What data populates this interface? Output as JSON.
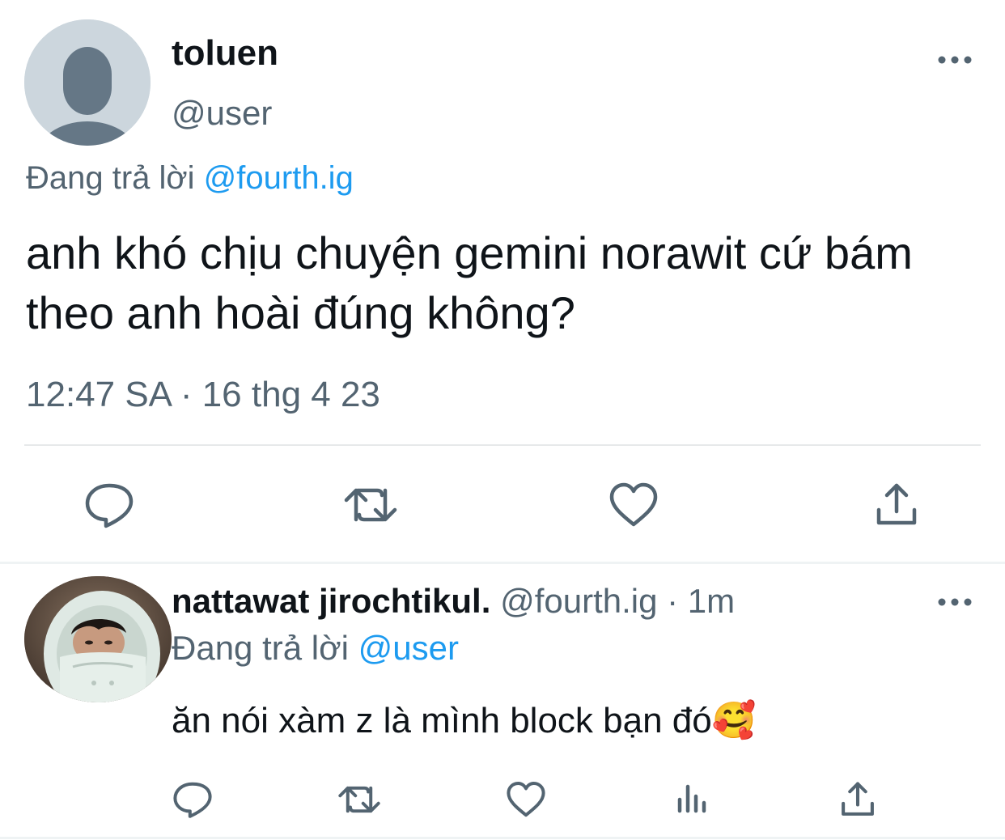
{
  "tweet": {
    "author": {
      "name": "toluen",
      "handle": "@user"
    },
    "replying_to": {
      "prefix": "Đang trả lời",
      "mention": "@fourth.ig"
    },
    "text": "anh khó chịu chuyện gemini norawit cứ bám theo anh hoài đúng không?",
    "timestamp": "12:47 SA · 16 thg 4 23",
    "actions": [
      "reply-icon",
      "retweet-icon",
      "like-icon",
      "share-icon"
    ],
    "more_icon": "more-horizontal-icon"
  },
  "reply": {
    "author": {
      "name": "nattawat jirochtikul.",
      "handle": "@fourth.ig",
      "time": "· 1m"
    },
    "replying_to": {
      "prefix": "Đang trả lời",
      "mention": "@user"
    },
    "text": "ăn nói xàm z là mình block bạn đó",
    "emoji": "🥰",
    "actions": [
      "reply-icon",
      "retweet-icon",
      "like-icon",
      "analytics-icon",
      "share-icon"
    ],
    "more_icon": "more-horizontal-icon"
  },
  "colors": {
    "text_primary": "#0f1419",
    "text_secondary": "#536471",
    "link": "#1d9bf0",
    "divider": "#e7e9ea",
    "avatar_placeholder": "#ccd6dd",
    "avatar_silhouette": "#657786"
  }
}
